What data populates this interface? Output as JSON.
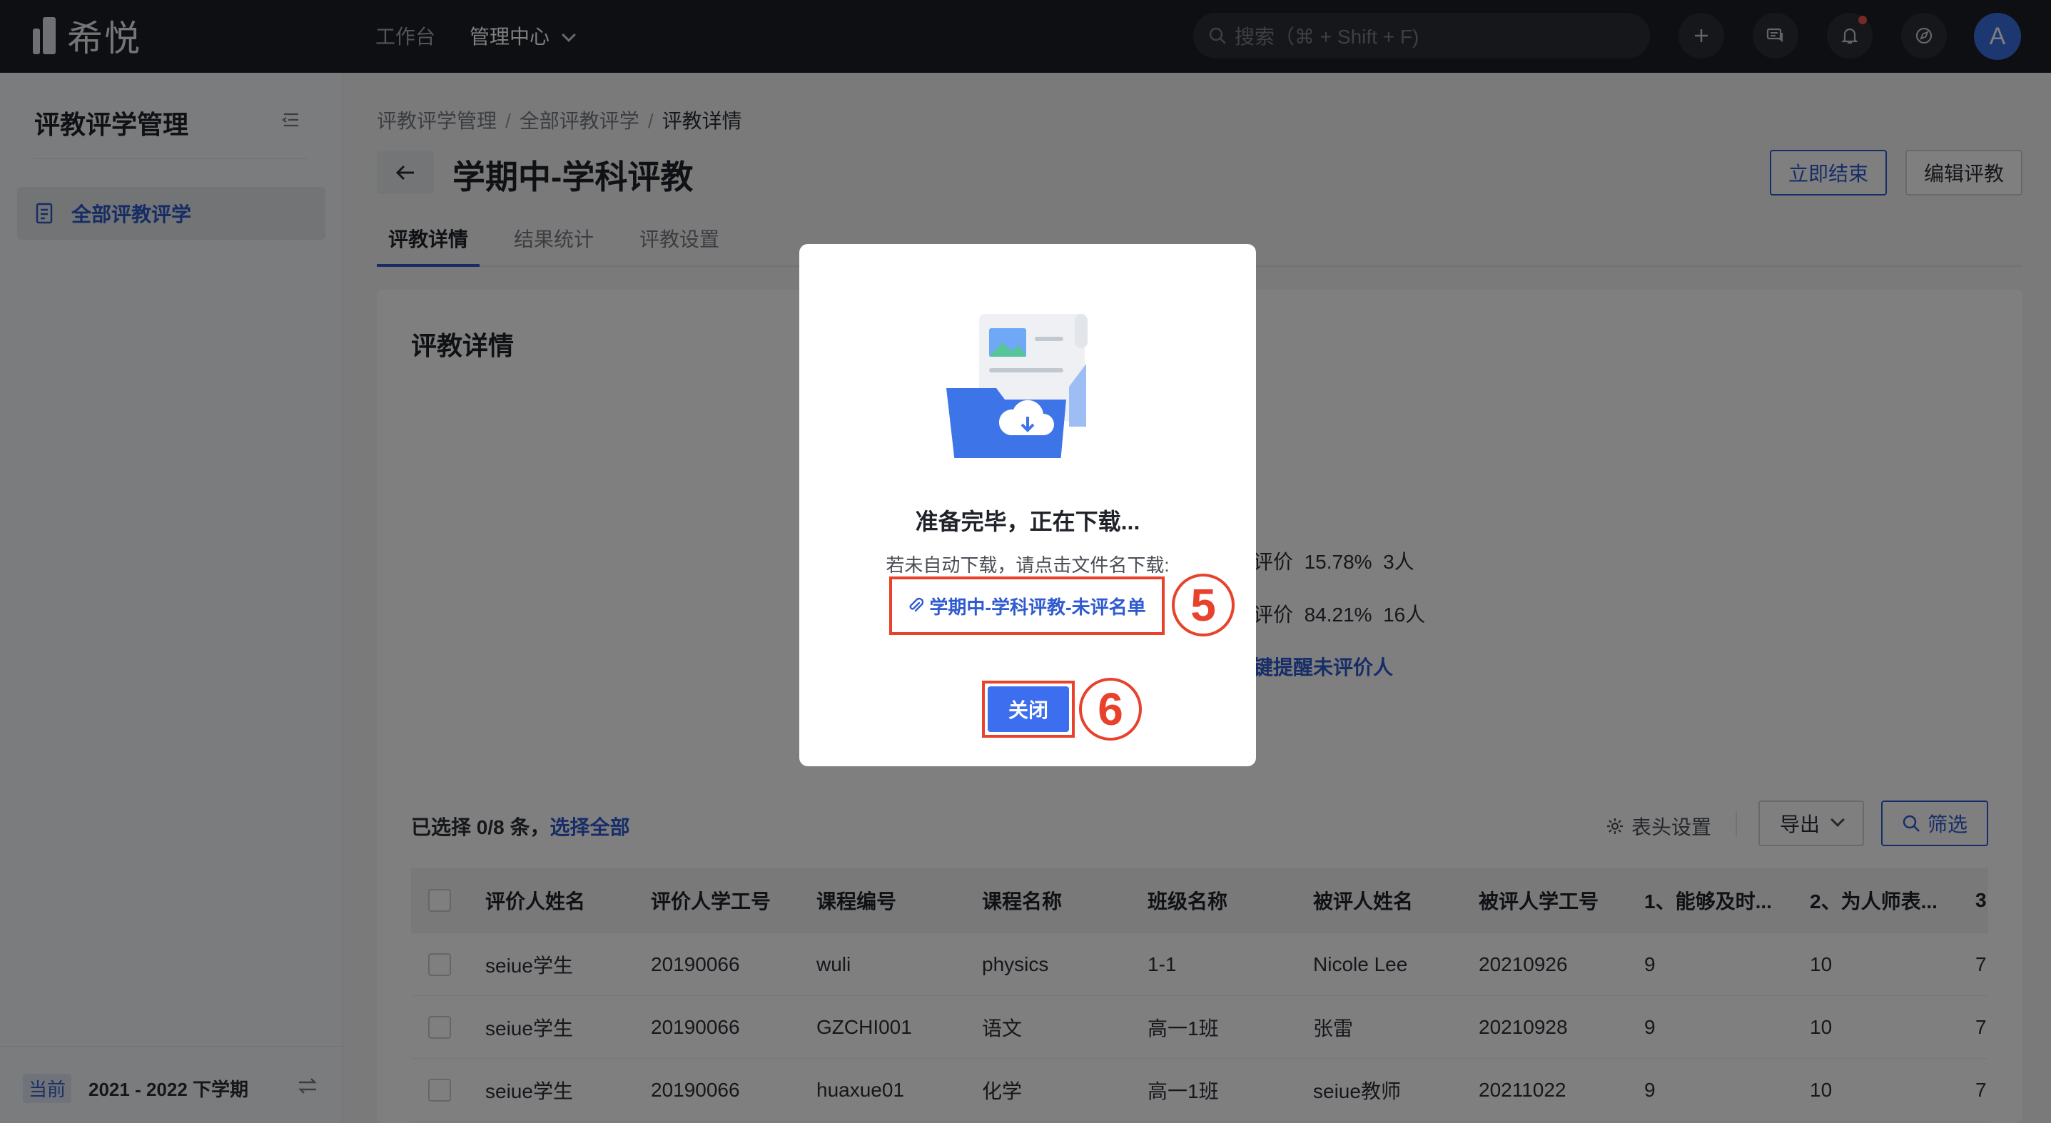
{
  "app": {
    "logo_text": "希悦"
  },
  "topbar": {
    "nav": [
      "工作台",
      "管理中心"
    ],
    "search_placeholder": "搜索（⌘ + Shift + F)",
    "avatar": "A"
  },
  "sidebar": {
    "title": "评教评学管理",
    "items": [
      {
        "label": "全部评教评学"
      }
    ],
    "term_tag": "当前",
    "term": "2021 - 2022 下学期"
  },
  "breadcrumb": [
    "评教评学管理",
    "全部评教评学",
    "评教详情"
  ],
  "page": {
    "title": "学期中-学科评教",
    "end_button": "立即结束",
    "edit_button": "编辑评教",
    "tabs": [
      "评教详情",
      "结果统计",
      "评教设置"
    ]
  },
  "card": {
    "title": "评教详情",
    "stats": [
      {
        "label": "评价",
        "percent": "15.78%",
        "count": "3人"
      },
      {
        "label": "评价",
        "percent": "84.21%",
        "count": "16人"
      }
    ],
    "remind_link": "键提醒未评价人",
    "selected_prefix": "已选择 0/8 条，",
    "select_all": "选择全部",
    "head_settings": "表头设置",
    "export": "导出",
    "filter": "筛选"
  },
  "table": {
    "columns": [
      "评价人姓名",
      "评价人学工号",
      "课程编号",
      "课程名称",
      "班级名称",
      "被评人姓名",
      "被评人学工号",
      "1、能够及时...",
      "2、为人师表...",
      "3"
    ],
    "rows": [
      [
        "seiue学生",
        "20190066",
        "wuli",
        "physics",
        "1-1",
        "Nicole Lee",
        "20210926",
        "9",
        "10",
        "7"
      ],
      [
        "seiue学生",
        "20190066",
        "GZCHI001",
        "语文",
        "高一1班",
        "张雷",
        "20210928",
        "9",
        "10",
        "7"
      ],
      [
        "seiue学生",
        "20190066",
        "huaxue01",
        "化学",
        "高一1班",
        "seiue教师",
        "20211022",
        "9",
        "10",
        "7"
      ]
    ]
  },
  "modal": {
    "title": "准备完毕，正在下载...",
    "hint": "若未自动下载，请点击文件名下载:",
    "file_name": "学期中-学科评教-未评名单",
    "close": "关闭",
    "marker_file": "5",
    "marker_close": "6"
  },
  "colors": {
    "accent": "#2f5bd1",
    "annotation": "#e8412c",
    "topbar": "#1d1f24"
  }
}
